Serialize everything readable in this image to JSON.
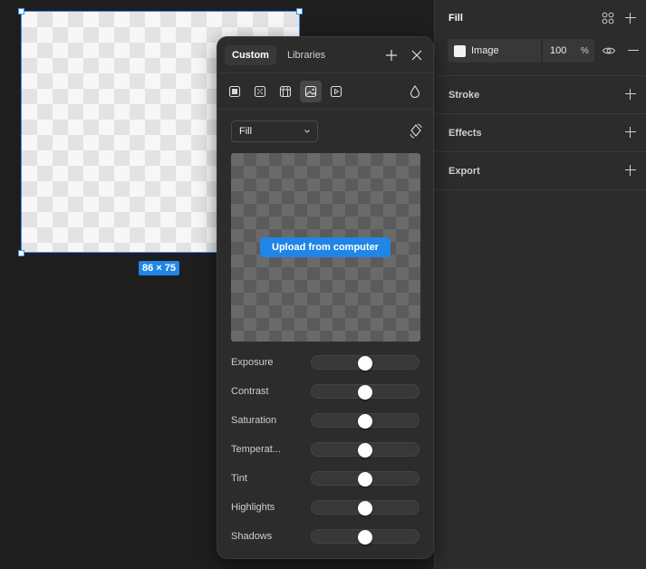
{
  "canvas": {
    "size_badge": "86 × 75"
  },
  "panel": {
    "fill": {
      "title": "Fill",
      "layer_type": "Image",
      "opacity": "100",
      "opacity_unit": "%"
    },
    "stroke_title": "Stroke",
    "effects_title": "Effects",
    "export_title": "Export"
  },
  "picker": {
    "tabs": {
      "custom": "Custom",
      "libraries": "Libraries"
    },
    "fill_types": [
      "solid-icon",
      "gradient-icon",
      "pattern-icon",
      "image-icon",
      "video-icon"
    ],
    "active_fill_type": "image-icon",
    "mode": "Fill",
    "upload_label": "Upload from computer",
    "adjustments": [
      {
        "label": "Exposure",
        "value": 0.5
      },
      {
        "label": "Contrast",
        "value": 0.5
      },
      {
        "label": "Saturation",
        "value": 0.5
      },
      {
        "label": "Temperat...",
        "value": 0.5
      },
      {
        "label": "Tint",
        "value": 0.5
      },
      {
        "label": "Highlights",
        "value": 0.5
      },
      {
        "label": "Shadows",
        "value": 0.5
      }
    ]
  },
  "colors": {
    "accent": "#1f86e8",
    "selection": "#3d8ef0",
    "panel_bg": "#2c2c2c",
    "canvas_bg": "#1e1e1e"
  }
}
